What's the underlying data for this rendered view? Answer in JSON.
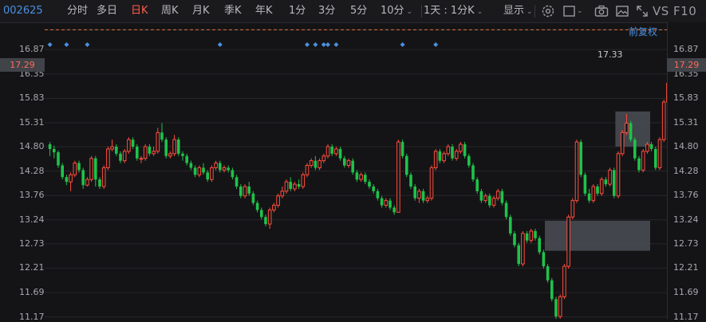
{
  "toolbar": {
    "stock_code": "002625",
    "tabs": [
      "分时",
      "多日",
      "日K",
      "周K",
      "月K",
      "季K",
      "年K",
      "1分",
      "3分",
      "5分",
      "10分"
    ],
    "active_tab": "日K",
    "period_select": "1天 : 1分K",
    "display_label": "显示",
    "right_text": "VS F10"
  },
  "chart_controls": {
    "restore_label": "前复权"
  },
  "colors": {
    "up": "#ff4d3d",
    "down": "#1fc24a",
    "background": "#141416",
    "accent": "#4a8fe0",
    "current_line": "#e0703a"
  },
  "price_axis": {
    "labels": [
      "17.29",
      "16.87",
      "16.35",
      "15.83",
      "15.31",
      "14.80",
      "14.28",
      "13.76",
      "13.24",
      "12.73",
      "12.21",
      "11.69",
      "11.17"
    ],
    "current_price": "17.29"
  },
  "highest_price_label": "17.33",
  "chart_data": {
    "type": "candlestick",
    "ylim": [
      11.13,
      17.45
    ],
    "ohlc": [
      [
        14.85,
        14.75,
        14.9,
        14.6
      ],
      [
        14.75,
        14.68,
        14.82,
        14.55
      ],
      [
        14.68,
        14.4,
        14.72,
        14.35
      ],
      [
        14.4,
        14.15,
        14.45,
        14.1
      ],
      [
        14.15,
        14.05,
        14.2,
        13.98
      ],
      [
        14.05,
        14.2,
        14.25,
        13.85
      ],
      [
        14.2,
        14.45,
        14.5,
        14.15
      ],
      [
        14.45,
        14.3,
        14.5,
        14.25
      ],
      [
        14.3,
        13.98,
        14.35,
        13.9
      ],
      [
        13.98,
        14.1,
        14.15,
        13.95
      ],
      [
        14.1,
        14.55,
        14.6,
        14.05
      ],
      [
        14.55,
        14.1,
        14.6,
        13.95
      ],
      [
        14.1,
        13.95,
        14.15,
        13.9
      ],
      [
        13.95,
        14.35,
        14.4,
        13.9
      ],
      [
        14.35,
        14.75,
        14.8,
        14.3
      ],
      [
        14.75,
        14.8,
        14.95,
        14.7
      ],
      [
        14.8,
        14.65,
        14.85,
        14.6
      ],
      [
        14.65,
        14.5,
        14.7,
        14.45
      ],
      [
        14.5,
        14.7,
        14.75,
        14.45
      ],
      [
        14.7,
        14.95,
        15.0,
        14.65
      ],
      [
        14.95,
        14.8,
        15.0,
        14.75
      ],
      [
        14.8,
        14.55,
        14.85,
        14.5
      ],
      [
        14.55,
        14.55,
        14.6,
        14.45
      ],
      [
        14.55,
        14.8,
        14.85,
        14.5
      ],
      [
        14.8,
        14.65,
        14.85,
        14.6
      ],
      [
        14.65,
        14.7,
        14.8,
        14.6
      ],
      [
        14.7,
        15.1,
        15.2,
        14.65
      ],
      [
        15.1,
        14.95,
        15.3,
        14.9
      ],
      [
        14.95,
        14.6,
        15.0,
        14.55
      ],
      [
        14.6,
        14.65,
        14.7,
        14.55
      ],
      [
        14.65,
        14.95,
        15.05,
        14.6
      ],
      [
        14.95,
        14.65,
        15.0,
        14.6
      ],
      [
        14.65,
        14.6,
        14.7,
        14.5
      ],
      [
        14.6,
        14.45,
        14.65,
        14.4
      ],
      [
        14.45,
        14.35,
        14.5,
        14.3
      ],
      [
        14.35,
        14.2,
        14.4,
        14.15
      ],
      [
        14.2,
        14.35,
        14.4,
        14.15
      ],
      [
        14.35,
        14.25,
        14.45,
        14.2
      ],
      [
        14.25,
        14.1,
        14.3,
        14.05
      ],
      [
        14.1,
        14.35,
        14.4,
        14.05
      ],
      [
        14.35,
        14.45,
        14.5,
        14.3
      ],
      [
        14.45,
        14.3,
        14.5,
        14.25
      ],
      [
        14.3,
        14.35,
        14.4,
        14.25
      ],
      [
        14.35,
        14.3,
        14.4,
        14.25
      ],
      [
        14.3,
        14.15,
        14.35,
        14.1
      ],
      [
        14.15,
        13.95,
        14.2,
        13.9
      ],
      [
        13.95,
        13.75,
        14.0,
        13.7
      ],
      [
        13.75,
        13.95,
        14.0,
        13.7
      ],
      [
        13.95,
        13.8,
        14.05,
        13.75
      ],
      [
        13.8,
        13.6,
        13.85,
        13.55
      ],
      [
        13.6,
        13.45,
        13.65,
        13.4
      ],
      [
        13.45,
        13.3,
        13.5,
        13.25
      ],
      [
        13.3,
        13.15,
        13.35,
        13.1
      ],
      [
        13.15,
        13.45,
        13.5,
        13.05
      ],
      [
        13.45,
        13.55,
        13.6,
        13.4
      ],
      [
        13.55,
        13.75,
        13.8,
        13.5
      ],
      [
        13.75,
        13.85,
        13.95,
        13.7
      ],
      [
        13.85,
        14.05,
        14.1,
        13.8
      ],
      [
        14.05,
        13.9,
        14.15,
        13.85
      ],
      [
        13.9,
        14.0,
        14.05,
        13.85
      ],
      [
        14.0,
        13.95,
        14.1,
        13.9
      ],
      [
        13.95,
        14.2,
        14.25,
        13.9
      ],
      [
        14.2,
        14.4,
        14.45,
        14.15
      ],
      [
        14.4,
        14.5,
        14.55,
        14.35
      ],
      [
        14.5,
        14.35,
        14.6,
        14.3
      ],
      [
        14.35,
        14.5,
        14.55,
        14.3
      ],
      [
        14.5,
        14.6,
        14.65,
        14.45
      ],
      [
        14.6,
        14.8,
        14.85,
        14.55
      ],
      [
        14.8,
        14.65,
        14.85,
        14.6
      ],
      [
        14.65,
        14.75,
        14.8,
        14.6
      ],
      [
        14.75,
        14.55,
        14.8,
        14.5
      ],
      [
        14.55,
        14.4,
        14.6,
        14.35
      ],
      [
        14.4,
        14.5,
        14.55,
        14.35
      ],
      [
        14.5,
        14.25,
        14.55,
        14.2
      ],
      [
        14.25,
        14.1,
        14.3,
        14.05
      ],
      [
        14.1,
        14.2,
        14.25,
        14.05
      ],
      [
        14.2,
        14.05,
        14.25,
        14.0
      ],
      [
        14.05,
        13.95,
        14.1,
        13.9
      ],
      [
        13.95,
        13.85,
        14.0,
        13.8
      ],
      [
        13.85,
        13.7,
        13.9,
        13.65
      ],
      [
        13.7,
        13.55,
        13.75,
        13.5
      ],
      [
        13.55,
        13.65,
        13.7,
        13.5
      ],
      [
        13.65,
        13.5,
        13.7,
        13.45
      ],
      [
        13.5,
        13.4,
        13.55,
        13.35
      ],
      [
        13.4,
        14.9,
        14.95,
        13.4
      ],
      [
        14.9,
        14.6,
        14.95,
        14.55
      ],
      [
        14.6,
        14.2,
        14.65,
        14.15
      ],
      [
        14.2,
        13.95,
        14.25,
        13.9
      ],
      [
        13.95,
        13.7,
        14.0,
        13.65
      ],
      [
        13.7,
        13.85,
        13.9,
        13.6
      ],
      [
        13.85,
        13.65,
        13.9,
        13.6
      ],
      [
        13.65,
        13.7,
        13.75,
        13.6
      ],
      [
        13.7,
        14.35,
        14.4,
        13.65
      ],
      [
        14.35,
        14.7,
        14.75,
        14.3
      ],
      [
        14.7,
        14.5,
        14.75,
        14.45
      ],
      [
        14.5,
        14.65,
        14.7,
        14.45
      ],
      [
        14.65,
        14.8,
        14.85,
        14.6
      ],
      [
        14.8,
        14.55,
        14.85,
        14.5
      ],
      [
        14.55,
        14.7,
        14.75,
        14.5
      ],
      [
        14.7,
        14.85,
        14.9,
        14.65
      ],
      [
        14.85,
        14.6,
        14.9,
        14.55
      ],
      [
        14.6,
        14.4,
        14.65,
        14.35
      ],
      [
        14.4,
        14.1,
        14.45,
        14.05
      ],
      [
        14.1,
        13.85,
        14.15,
        13.8
      ],
      [
        13.85,
        13.65,
        13.9,
        13.6
      ],
      [
        13.65,
        13.75,
        13.8,
        13.6
      ],
      [
        13.75,
        13.55,
        13.8,
        13.5
      ],
      [
        13.55,
        13.7,
        13.75,
        13.5
      ],
      [
        13.7,
        13.85,
        13.9,
        13.65
      ],
      [
        13.85,
        13.6,
        13.9,
        13.55
      ],
      [
        13.6,
        13.3,
        13.65,
        13.25
      ],
      [
        13.3,
        12.95,
        13.35,
        12.9
      ],
      [
        12.95,
        12.7,
        13.0,
        12.65
      ],
      [
        12.7,
        12.3,
        12.75,
        12.25
      ],
      [
        12.3,
        12.95,
        13.0,
        12.25
      ],
      [
        12.95,
        12.8,
        13.0,
        12.75
      ],
      [
        12.8,
        13.0,
        13.05,
        12.75
      ],
      [
        13.0,
        12.85,
        13.05,
        12.8
      ],
      [
        12.85,
        12.55,
        12.9,
        12.5
      ],
      [
        12.55,
        12.25,
        12.6,
        12.2
      ],
      [
        12.25,
        11.95,
        12.3,
        11.9
      ],
      [
        11.95,
        11.55,
        12.0,
        11.5
      ],
      [
        11.55,
        11.18,
        11.6,
        11.13
      ],
      [
        11.18,
        11.6,
        11.65,
        11.13
      ],
      [
        11.6,
        12.25,
        12.3,
        11.55
      ],
      [
        12.25,
        13.3,
        13.35,
        12.2
      ],
      [
        13.3,
        13.65,
        13.7,
        13.25
      ],
      [
        13.65,
        14.9,
        14.95,
        13.6
      ],
      [
        14.9,
        14.2,
        14.95,
        14.15
      ],
      [
        14.2,
        13.8,
        14.25,
        13.75
      ],
      [
        13.8,
        13.65,
        13.9,
        13.6
      ],
      [
        13.65,
        13.95,
        14.0,
        13.6
      ],
      [
        13.95,
        13.8,
        14.0,
        13.75
      ],
      [
        13.8,
        14.1,
        14.15,
        13.75
      ],
      [
        14.1,
        14.0,
        14.15,
        13.95
      ],
      [
        14.0,
        14.3,
        14.35,
        13.95
      ],
      [
        14.3,
        13.75,
        14.35,
        13.7
      ],
      [
        13.75,
        14.65,
        14.7,
        13.7
      ],
      [
        14.65,
        15.1,
        15.15,
        14.6
      ],
      [
        15.1,
        15.3,
        15.5,
        15.05
      ],
      [
        15.3,
        14.95,
        15.35,
        14.9
      ],
      [
        14.95,
        14.55,
        15.0,
        14.5
      ],
      [
        14.55,
        14.3,
        14.6,
        14.25
      ],
      [
        14.3,
        14.7,
        14.75,
        14.25
      ],
      [
        14.7,
        14.85,
        14.9,
        14.65
      ],
      [
        14.85,
        14.75,
        14.9,
        14.7
      ],
      [
        14.75,
        14.35,
        14.8,
        14.3
      ],
      [
        14.35,
        14.95,
        15.0,
        14.3
      ],
      [
        14.95,
        15.75,
        15.8,
        14.9
      ],
      [
        15.75,
        16.15,
        16.2,
        15.7
      ],
      [
        16.15,
        15.55,
        16.2,
        15.5
      ],
      [
        15.55,
        16.35,
        16.4,
        15.5
      ],
      [
        16.35,
        16.75,
        16.8,
        16.3
      ],
      [
        16.75,
        16.35,
        16.8,
        16.3
      ],
      [
        16.35,
        17.29,
        17.33,
        16.3
      ]
    ],
    "gap_zones": [
      {
        "label": "gap-upper",
        "from_index": 137,
        "to_index": 144,
        "low": 14.8,
        "high": 15.55
      },
      {
        "label": "gap-lower",
        "from_index": 120,
        "to_index": 144,
        "low": 12.58,
        "high": 13.22
      }
    ],
    "event_marker_indices": [
      0,
      4,
      9,
      41,
      62,
      64,
      66,
      67,
      69,
      85,
      93
    ]
  }
}
